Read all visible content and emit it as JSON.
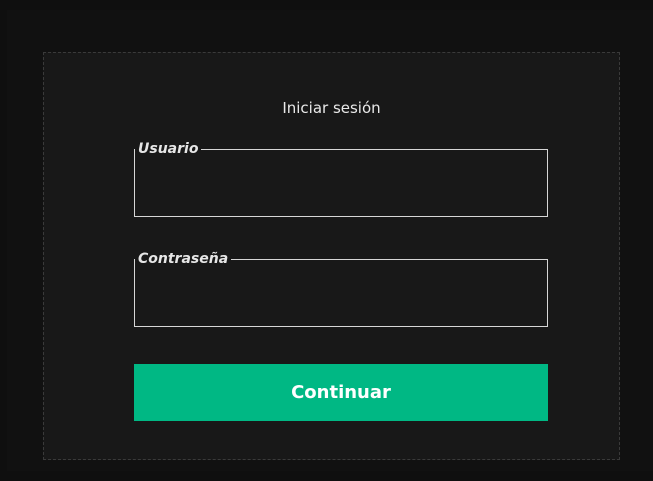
{
  "login": {
    "title": "Iniciar sesión",
    "username_label": "Usuario",
    "username_value": "",
    "password_label": "Contraseña",
    "password_value": "",
    "submit_label": "Continuar"
  },
  "colors": {
    "accent": "#00b884",
    "background": "#0f0f0f",
    "panel": "#181818",
    "field_border": "#d6d6d6"
  }
}
